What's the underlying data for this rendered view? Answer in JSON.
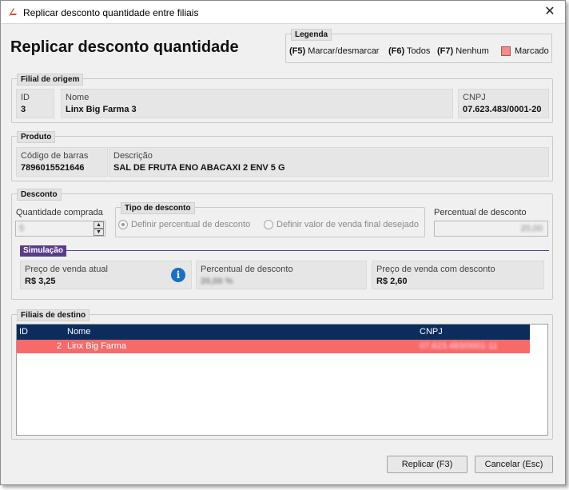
{
  "window": {
    "title": "Replicar desconto quantidade entre filiais",
    "close_glyph": "✕"
  },
  "header": {
    "title": "Replicar desconto quantidade"
  },
  "legend": {
    "title": "Legenda",
    "items": [
      {
        "key": "(F5)",
        "label": "Marcar/desmarcar"
      },
      {
        "key": "(F6)",
        "label": "Todos"
      },
      {
        "key": "(F7)",
        "label": "Nenhum"
      }
    ],
    "marked_label": "Marcado",
    "marked_color": "#f4898a"
  },
  "origem": {
    "title": "Filial de origem",
    "id_label": "ID",
    "id_value": "3",
    "nome_label": "Nome",
    "nome_value": "Linx Big Farma 3",
    "cnpj_label": "CNPJ",
    "cnpj_value": "07.623.483/0001-20"
  },
  "produto": {
    "title": "Produto",
    "barcode_label": "Código de barras",
    "barcode_value": "7896015521646",
    "desc_label": "Descrição",
    "desc_value": "SAL DE FRUTA ENO ABACAXI 2 ENV 5 G"
  },
  "desconto": {
    "title": "Desconto",
    "qty_label": "Quantidade comprada",
    "qty_value": "5",
    "tipo_title": "Tipo de desconto",
    "radio1": "Definir percentual de desconto",
    "radio2": "Definir valor de venda final desejado",
    "perc_label": "Percentual de desconto",
    "perc_value": "20,00"
  },
  "simulacao": {
    "title": "Simulação",
    "preco_atual_label": "Preço de venda atual",
    "preco_atual_value": "R$ 3,25",
    "perc_label": "Percentual de desconto",
    "perc_value": "20,00 %",
    "preco_desc_label": "Preço de venda com desconto",
    "preco_desc_value": "R$ 2,60"
  },
  "destino": {
    "title": "Filiais de destino",
    "columns": [
      "ID",
      "Nome",
      "CNPJ"
    ],
    "rows": [
      {
        "id": "2",
        "nome": "Linx Big Farma",
        "cnpj": "07.623.483/0001-11"
      }
    ]
  },
  "buttons": {
    "replicar": "Replicar (F3)",
    "cancelar": "Cancelar (Esc)"
  },
  "colors": {
    "table_header": "#0a2d5e",
    "marked_row": "#f76a6a",
    "simulacao_accent": "#5a3b8a",
    "info_icon": "#1a6fc4"
  }
}
